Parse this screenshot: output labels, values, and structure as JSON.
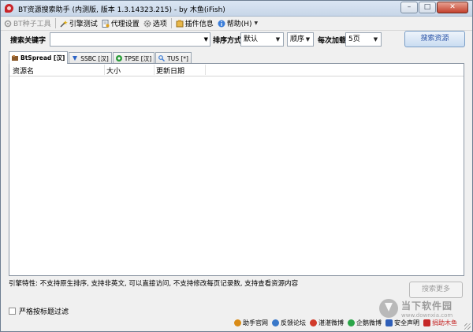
{
  "window": {
    "title": "BT资源搜索助手 (内测版, 版本 1.3.14323.215) - by 木鱼(iFish)",
    "minimize": "–",
    "maximize": "□",
    "close": "✕"
  },
  "menu": {
    "bt_tools": "BT种子工具",
    "engine_test": "引擎测试",
    "proxy": "代理设置",
    "options": "选项",
    "plugins": "插件信息",
    "help": "帮助(H)"
  },
  "search": {
    "keyword_label": "搜索关键字",
    "keyword_value": "",
    "sort_label": "排序方式",
    "sort_value": "默认",
    "order_value": "顺序",
    "load_label": "每次加载",
    "load_value": "5页",
    "button": "搜索资源"
  },
  "tabs": [
    {
      "label": "BtSpread [汉]",
      "icon": "bt-spread-icon",
      "color": "#7a4a1e"
    },
    {
      "label": "SSBC [汉]",
      "icon": "ssbc-icon",
      "color": "#2b63c6"
    },
    {
      "label": "TPSE [汉]",
      "icon": "tpse-icon",
      "color": "#2c9c3a"
    },
    {
      "label": "TUS [*]",
      "icon": "tus-icon",
      "color": "#3a7bd5"
    }
  ],
  "table": {
    "columns": [
      "资源名",
      "大小",
      "更新日期"
    ]
  },
  "engine_feature": "引擎特性: 不支持原生排序, 支持非英文, 可以直接访问, 不支持修改每页记录数, 支持查看资源内容",
  "more_button": "搜索更多",
  "title_filter": "严格按标题过滤",
  "footer_links": [
    {
      "label": "助手官网",
      "color": "#d98b17"
    },
    {
      "label": "反馈论坛",
      "color": "#3a78c9"
    },
    {
      "label": "湛湛微博",
      "color": "#d13a2a"
    },
    {
      "label": "企鹅微博",
      "color": "#2aa548"
    },
    {
      "label": "安全声明",
      "color": "#2f5fb8"
    },
    {
      "label": "捐助木鱼",
      "color": "#c62828"
    }
  ],
  "watermark": {
    "title": "当下软件园",
    "url": "www.downxia.com"
  }
}
